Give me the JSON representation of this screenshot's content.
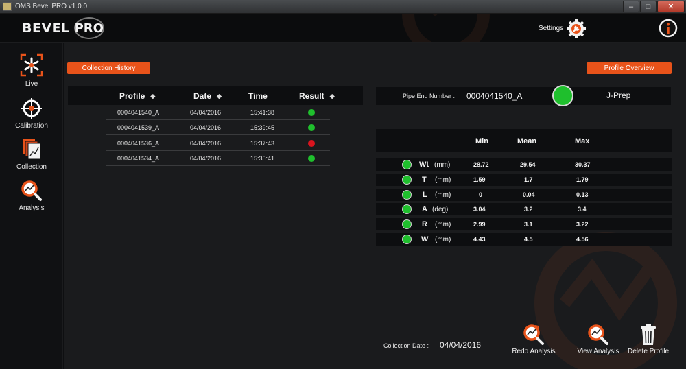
{
  "window": {
    "title": "OMS Bevel PRO v1.0.0",
    "min": "–",
    "max": "□",
    "close": "✕"
  },
  "header": {
    "logo_text": "BEVEL",
    "logo_pro": "PRO",
    "settings_label": "Settings"
  },
  "sidebar": {
    "items": [
      {
        "label": "Live",
        "icon": "live-icon"
      },
      {
        "label": "Calibration",
        "icon": "crosshair-icon"
      },
      {
        "label": "Collection",
        "icon": "collection-icon"
      },
      {
        "label": "Analysis",
        "icon": "analysis-icon"
      }
    ]
  },
  "history": {
    "title": "Collection History",
    "columns": {
      "profile": "Profile",
      "date": "Date",
      "time": "Time",
      "result": "Result"
    },
    "sort_glyph": "◆",
    "rows": [
      {
        "profile": "0004041540_A",
        "date": "04/04/2016",
        "time": "15:41:38",
        "status": "pass"
      },
      {
        "profile": "0004041539_A",
        "date": "04/04/2016",
        "time": "15:39:45",
        "status": "pass"
      },
      {
        "profile": "0004041536_A",
        "date": "04/04/2016",
        "time": "15:37:43",
        "status": "fail"
      },
      {
        "profile": "0004041534_A",
        "date": "04/04/2016",
        "time": "15:35:41",
        "status": "pass"
      }
    ]
  },
  "overview": {
    "title": "Profile Overview",
    "pipe_label": "Pipe End Number :",
    "pipe_value": "0004041540_A",
    "prep_type": "J-Prep",
    "columns": {
      "min": "Min",
      "mean": "Mean",
      "max": "Max"
    },
    "stats": [
      {
        "name": "Wt",
        "unit": "(mm)",
        "min": "28.72",
        "mean": "29.54",
        "max": "30.37"
      },
      {
        "name": "T",
        "unit": "(mm)",
        "min": "1.59",
        "mean": "1.7",
        "max": "1.79"
      },
      {
        "name": "L",
        "unit": "(mm)",
        "min": "0",
        "mean": "0.04",
        "max": "0.13"
      },
      {
        "name": "A",
        "unit": "(deg)",
        "min": "3.04",
        "mean": "3.2",
        "max": "3.4"
      },
      {
        "name": "R",
        "unit": "(mm)",
        "min": "2.99",
        "mean": "3.1",
        "max": "3.22"
      },
      {
        "name": "W",
        "unit": "(mm)",
        "min": "4.43",
        "mean": "4.5",
        "max": "4.56"
      }
    ],
    "collection_date_label": "Collection Date :",
    "collection_date": "04/04/2016"
  },
  "actions": {
    "redo": "Redo Analysis",
    "view": "View Analysis",
    "delete": "Delete Profile"
  },
  "colors": {
    "accent": "#e8531a",
    "pass": "#1fbf2d",
    "fail": "#d9141e",
    "background": "#1a1b1d"
  }
}
